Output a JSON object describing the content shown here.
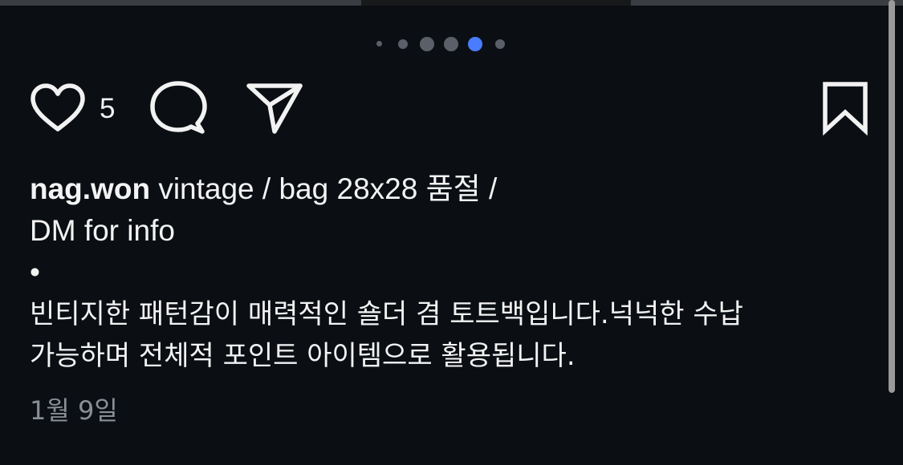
{
  "post": {
    "like_count": "5",
    "username": "nag.won",
    "caption_line1": "vintage / bag 28x28 품절 /",
    "caption_line2": "DM for info",
    "caption_bullet": "•",
    "caption_line3": "빈티지한 패턴감이 매력적인 숄더 겸 토트백입니다.넉넉한 수납",
    "caption_line4": "가능하며 전체적 포인트 아이템으로 활용됩니다.",
    "date": "1월 9일"
  },
  "carousel": {
    "total": 6,
    "active_index": 4,
    "active_color": "#4a7cff",
    "inactive_color": "#5b6068"
  },
  "icons": {
    "like": "heart-icon",
    "comment": "comment-icon",
    "share": "send-icon",
    "save": "bookmark-icon"
  }
}
